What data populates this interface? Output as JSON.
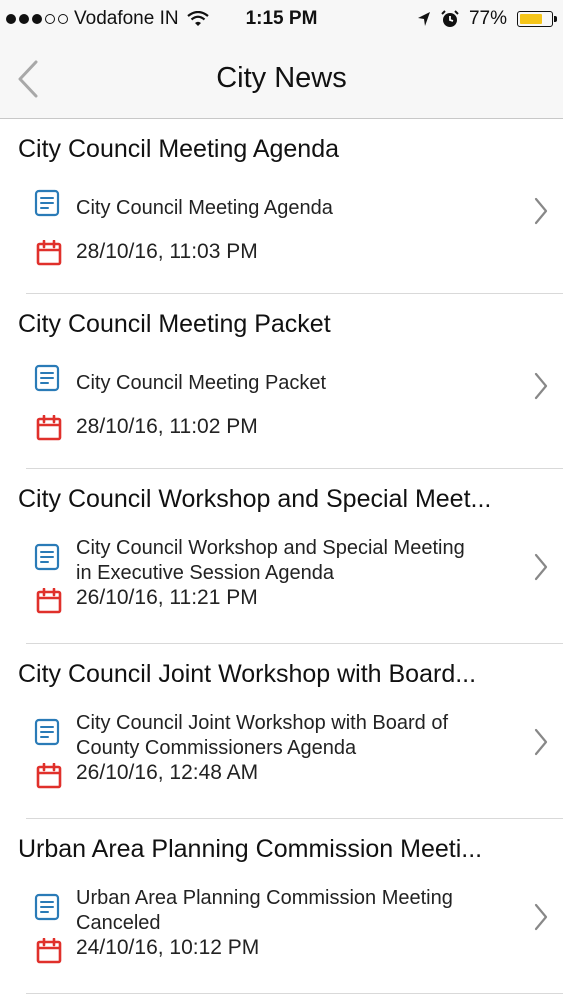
{
  "status_bar": {
    "carrier": "Vodafone IN",
    "time": "1:15 PM",
    "battery": "77%",
    "battery_level": 0.77
  },
  "nav": {
    "title": "City News",
    "back_icon": "chevron-left-icon"
  },
  "news_items": [
    {
      "title": "City Council Meeting Agenda",
      "description": "City Council Meeting Agenda",
      "date": "28/10/16, 11:03 PM"
    },
    {
      "title": "City Council Meeting Packet",
      "description": "City Council Meeting Packet",
      "date": "28/10/16, 11:02 PM"
    },
    {
      "title": "City Council Workshop and Special Meet...",
      "description_lines": [
        "City Council Workshop and Special Meeting",
        "in Executive Session Agenda"
      ],
      "date": "26/10/16, 11:21 PM"
    },
    {
      "title": "City Council Joint Workshop with Board...",
      "description_lines": [
        "City Council Joint Workshop with Board of",
        "County Commissioners Agenda"
      ],
      "date": "26/10/16, 12:48 AM"
    },
    {
      "title": "Urban Area Planning Commission Meeti...",
      "description_lines": [
        "Urban Area Planning Commission Meeting",
        "Canceled"
      ],
      "date": "24/10/16, 10:12 PM"
    }
  ],
  "colors": {
    "doc_icon": "#2a7bb7",
    "calendar_icon": "#e0302b",
    "battery": "#f5c518"
  }
}
